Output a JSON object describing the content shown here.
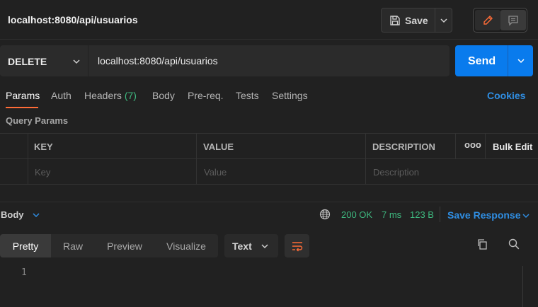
{
  "header": {
    "title": "localhost:8080/api/usuarios",
    "save_label": "Save",
    "icons": {
      "save": "floppy-disk-icon",
      "dropdown": "chevron-down-icon",
      "edit": "pencil-icon",
      "comment": "comment-icon"
    }
  },
  "request": {
    "method": "DELETE",
    "url": "localhost:8080/api/usuarios",
    "send_label": "Send"
  },
  "tabs": {
    "params": "Params",
    "auth": "Auth",
    "headers": "Headers",
    "headers_count": "(7)",
    "body": "Body",
    "prereq": "Pre-req.",
    "tests": "Tests",
    "settings": "Settings",
    "cookies": "Cookies",
    "active": "Params"
  },
  "query_params": {
    "title": "Query Params",
    "columns": {
      "key": "KEY",
      "value": "VALUE",
      "description": "DESCRIPTION",
      "more": "ooo",
      "bulk_edit": "Bulk Edit"
    },
    "placeholders": {
      "key": "Key",
      "value": "Value",
      "description": "Description"
    }
  },
  "response": {
    "body_label": "Body",
    "status": "200 OK",
    "time": "7 ms",
    "size": "123 B",
    "save_response": "Save Response",
    "view_tabs": [
      "Pretty",
      "Raw",
      "Preview",
      "Visualize"
    ],
    "active_view": "Pretty",
    "format": "Text",
    "line_numbers": [
      "1"
    ]
  },
  "colors": {
    "accent_blue": "#097bed",
    "link_blue": "#2f8ee3",
    "success_green": "#3eb87f",
    "active_tab_underline": "#ff6c37",
    "wrap_icon": "#ff6c37"
  }
}
